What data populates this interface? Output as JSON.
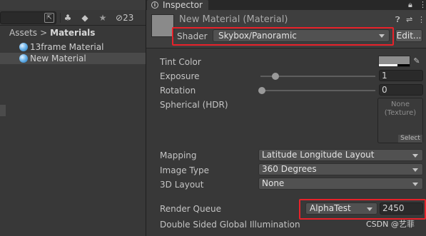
{
  "project": {
    "hidden_count": "23",
    "breadcrumb": {
      "root": "Assets",
      "separator": ">",
      "current": "Materials"
    },
    "assets": [
      {
        "name": "13frame Material",
        "selected": false
      },
      {
        "name": "New Material",
        "selected": true
      }
    ],
    "icons": [
      "pick-icon",
      "group-icon",
      "label-icon",
      "star-icon",
      "hidden-eye-icon"
    ]
  },
  "inspector": {
    "tab_label": "Inspector",
    "material_title": "New Material (Material)",
    "shader_label": "Shader",
    "shader_value": "Skybox/Panoramic",
    "edit_button": "Edit...",
    "properties": {
      "tint_label": "Tint Color",
      "exposure_label": "Exposure",
      "exposure_value": "1",
      "rotation_label": "Rotation",
      "rotation_value": "0",
      "spherical_label": "Spherical  (HDR)",
      "texture_none": "None",
      "texture_type": "(Texture)",
      "texture_select": "Select",
      "mapping_label": "Mapping",
      "mapping_value": "Latitude Longitude Layout",
      "image_type_label": "Image Type",
      "image_type_value": "360 Degrees",
      "layout_label": "3D Layout",
      "layout_value": "None",
      "render_queue_label": "Render Queue",
      "render_queue_mode": "AlphaTest",
      "render_queue_value": "2450",
      "dsgi_label": "Double Sided Global Illumination"
    }
  },
  "watermark": "CSDN @艺菲",
  "colors": {
    "highlight": "#e8222a",
    "panel": "#383838",
    "header": "#3e3e3e"
  }
}
